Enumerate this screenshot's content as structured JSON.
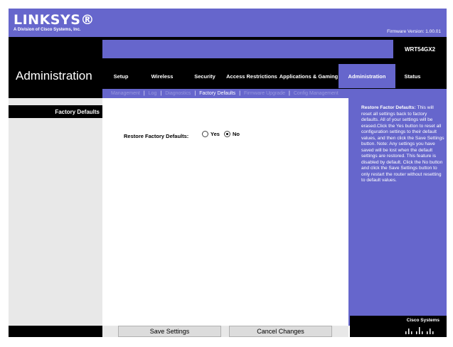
{
  "brand": {
    "logo": "LINKSYS®",
    "subtitle": "A Division of Cisco Systems, Inc."
  },
  "firmware": "Firmware Version: 1.00.01",
  "page_title": "Administration",
  "model": "WRT54GX2",
  "tabs": [
    {
      "label": "Setup"
    },
    {
      "label": "Wireless"
    },
    {
      "label": "Security"
    },
    {
      "label": "Access Restrictions"
    },
    {
      "label": "Applications & Gaming"
    },
    {
      "label": "Administration",
      "active": true
    },
    {
      "label": "Status"
    }
  ],
  "subnav": [
    {
      "label": "Management"
    },
    {
      "label": "Log"
    },
    {
      "label": "Diagnostics"
    },
    {
      "label": "Factory Defaults",
      "active": true
    },
    {
      "label": "Firmware Upgrade"
    },
    {
      "label": "Config Management"
    }
  ],
  "section_title": "Factory Defaults",
  "form": {
    "label": "Restore Factory Defaults:",
    "options": [
      {
        "label": "Yes",
        "selected": false
      },
      {
        "label": "No",
        "selected": true
      }
    ]
  },
  "help": {
    "title": "Restore Factor Defaults:",
    "text": "This will reset all settings back to factory defaults. All of your settings will be erased.Click the Yes button to reset all configuration settings to their default values, and then click the Save Settings button. Note: Any settings you have saved will be lost when the default settings are restored. This feature is disabled by default. Click the No button and click the Save Settings button to only restart the router without resetting to default values."
  },
  "cisco": "Cisco Systems",
  "buttons": {
    "save": "Save Settings",
    "cancel": "Cancel Changes"
  },
  "colors": {
    "accent": "#6666cc",
    "dark": "#000000",
    "panel": "#e8e8e8"
  }
}
